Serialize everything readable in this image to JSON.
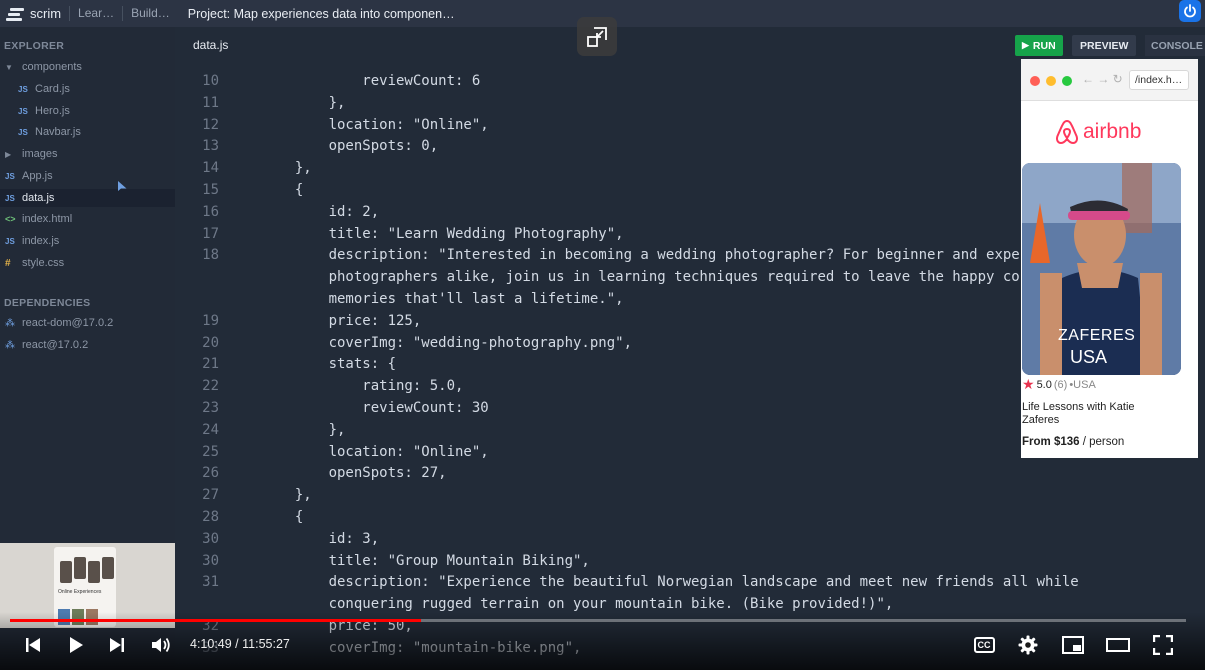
{
  "topbar": {
    "brand": "scrim",
    "crumbs": [
      "Lear…",
      "Build…"
    ],
    "project_title": "Project: Map experiences data into componen…"
  },
  "sidebar": {
    "explorer_heading": "EXPLORER",
    "dependencies_heading": "DEPENDENCIES",
    "files": {
      "components": "components",
      "card": "Card.js",
      "hero": "Hero.js",
      "navbar": "Navbar.js",
      "images": "images",
      "app": "App.js",
      "data": "data.js",
      "index_html": "index.html",
      "index_js": "index.js",
      "style": "style.css"
    },
    "deps": [
      "react-dom@17.0.2",
      "react@17.0.2"
    ]
  },
  "editor": {
    "tab": "data.js",
    "lines": [
      {
        "n": "10",
        "t": "            reviewCount: 6"
      },
      {
        "n": "11",
        "t": "        },"
      },
      {
        "n": "12",
        "t": "        location: \"Online\","
      },
      {
        "n": "13",
        "t": "        openSpots: 0,"
      },
      {
        "n": "14",
        "t": "    },"
      },
      {
        "n": "15",
        "t": "    {"
      },
      {
        "n": "16",
        "t": "        id: 2,"
      },
      {
        "n": "17",
        "t": "        title: \"Learn Wedding Photography\","
      },
      {
        "n": "18",
        "t": "        description: \"Interested in becoming a wedding photographer? For beginner and expe"
      },
      {
        "n": "",
        "t": "        photographers alike, join us in learning techniques required to leave the happy co"
      },
      {
        "n": "",
        "t": "        memories that'll last a lifetime.\","
      },
      {
        "n": "19",
        "t": "        price: 125,"
      },
      {
        "n": "20",
        "t": "        coverImg: \"wedding-photography.png\","
      },
      {
        "n": "21",
        "t": "        stats: {"
      },
      {
        "n": "22",
        "t": "            rating: 5.0,"
      },
      {
        "n": "23",
        "t": "            reviewCount: 30"
      },
      {
        "n": "24",
        "t": "        },"
      },
      {
        "n": "25",
        "t": "        location: \"Online\","
      },
      {
        "n": "26",
        "t": "        openSpots: 27,"
      },
      {
        "n": "27",
        "t": "    },"
      },
      {
        "n": "28",
        "t": "    {"
      },
      {
        "n": "30",
        "t": "        id: 3,"
      },
      {
        "n": "30",
        "t": "        title: \"Group Mountain Biking\","
      },
      {
        "n": "31",
        "t": "        description: \"Experience the beautiful Norwegian landscape and meet new friends all while"
      },
      {
        "n": "",
        "t": "        conquering rugged terrain on your mountain bike. (Bike provided!)\","
      },
      {
        "n": "32",
        "t": "        price: 50,"
      },
      {
        "n": "33",
        "t": "        coverImg: \"mountain-bike.png\","
      }
    ]
  },
  "toolbar": {
    "run": "RUN",
    "preview": "PREVIEW",
    "console": "CONSOLE"
  },
  "preview": {
    "url": "/index.h…",
    "brand": "airbnb",
    "jersey_line1": "ZAFERES",
    "jersey_line2": "USA",
    "rating": "5.0",
    "review_count": "(6)",
    "location": "•USA",
    "title": "Life Lessons with Katie Zaferes",
    "price_bold": "From $136",
    "price_rest": " / person"
  },
  "thumb": {
    "text1": "Online Experiences"
  },
  "player": {
    "time": "4:10:49 / 11:55:27",
    "progress": 0.3493,
    "cc_label": "CC"
  },
  "colors": {
    "accent": "#ff0000",
    "run": "#16a34a",
    "airbnb": "#ff385c"
  }
}
